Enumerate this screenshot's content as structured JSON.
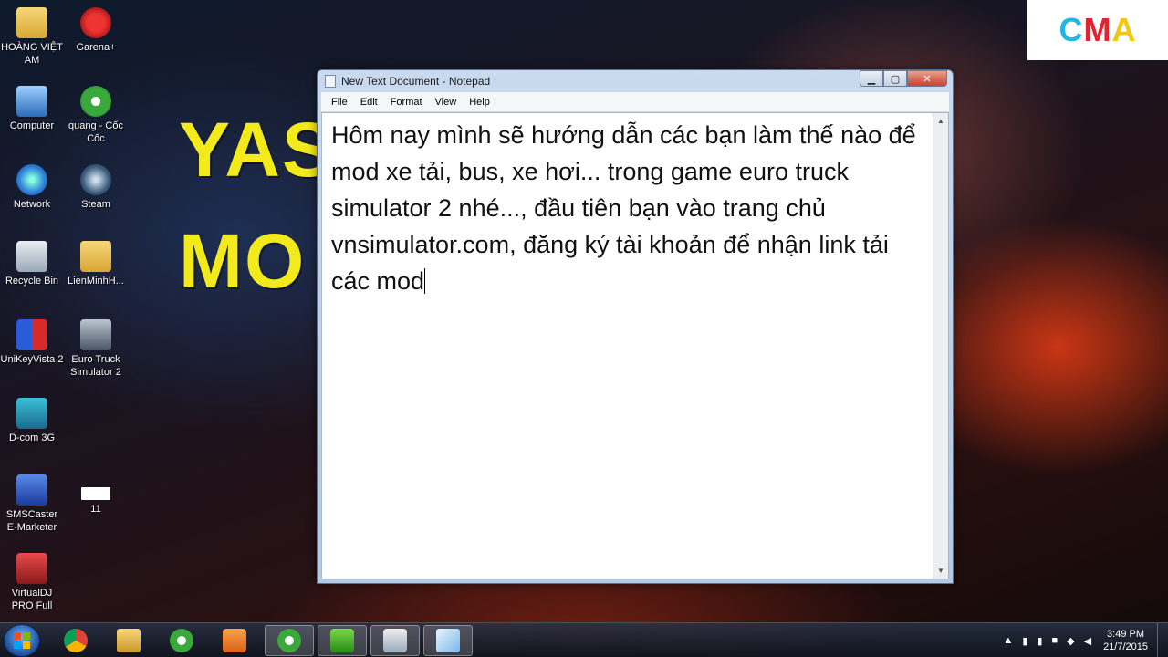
{
  "wallpaper": {
    "line1": "YAS",
    "line2": "MO"
  },
  "logo": {
    "c": "C",
    "m": "M",
    "a": "A"
  },
  "desktop_icons": [
    {
      "label": "HOÀNG VIỆT AM",
      "icon": "folder-icon"
    },
    {
      "label": "Garena+",
      "icon": "garena-icon"
    },
    {
      "label": "Computer",
      "icon": "computer-icon"
    },
    {
      "label": "quang - Cốc Cốc",
      "icon": "coccoc-icon"
    },
    {
      "label": "Network",
      "icon": "network-icon"
    },
    {
      "label": "Steam",
      "icon": "steam-icon"
    },
    {
      "label": "Recycle Bin",
      "icon": "recycle-bin-icon"
    },
    {
      "label": "LienMinhH...",
      "icon": "folder-icon"
    },
    {
      "label": "UniKeyVista 2",
      "icon": "unikey-icon"
    },
    {
      "label": "Euro Truck Simulator 2",
      "icon": "truck-icon"
    },
    {
      "label": "D-com 3G",
      "icon": "dcom-icon"
    },
    {
      "label": "SMSCaster E-Marketer",
      "icon": "smscaster-icon"
    },
    {
      "label": "11",
      "icon": "cma-file-icon"
    },
    {
      "label": "VirtualDJ PRO Full",
      "icon": "virtualdj-icon"
    }
  ],
  "notepad": {
    "title": "New Text Document - Notepad",
    "menu": [
      "File",
      "Edit",
      "Format",
      "View",
      "Help"
    ],
    "content": "Hôm nay mình sẽ hướng dẫn các bạn làm thế nào để mod xe tải, bus, xe hơi... trong game euro truck simulator 2 nhé..., đầu tiên bạn vào trang chủ vnsimulator.com, đăng ký tài khoản để nhận link tải các mod",
    "min_glyph": "▁",
    "max_glyph": "▢",
    "close_glyph": "✕"
  },
  "taskbar": {
    "time": "3:49 PM",
    "date": "21/7/2015",
    "tray_arrow": "▲"
  }
}
